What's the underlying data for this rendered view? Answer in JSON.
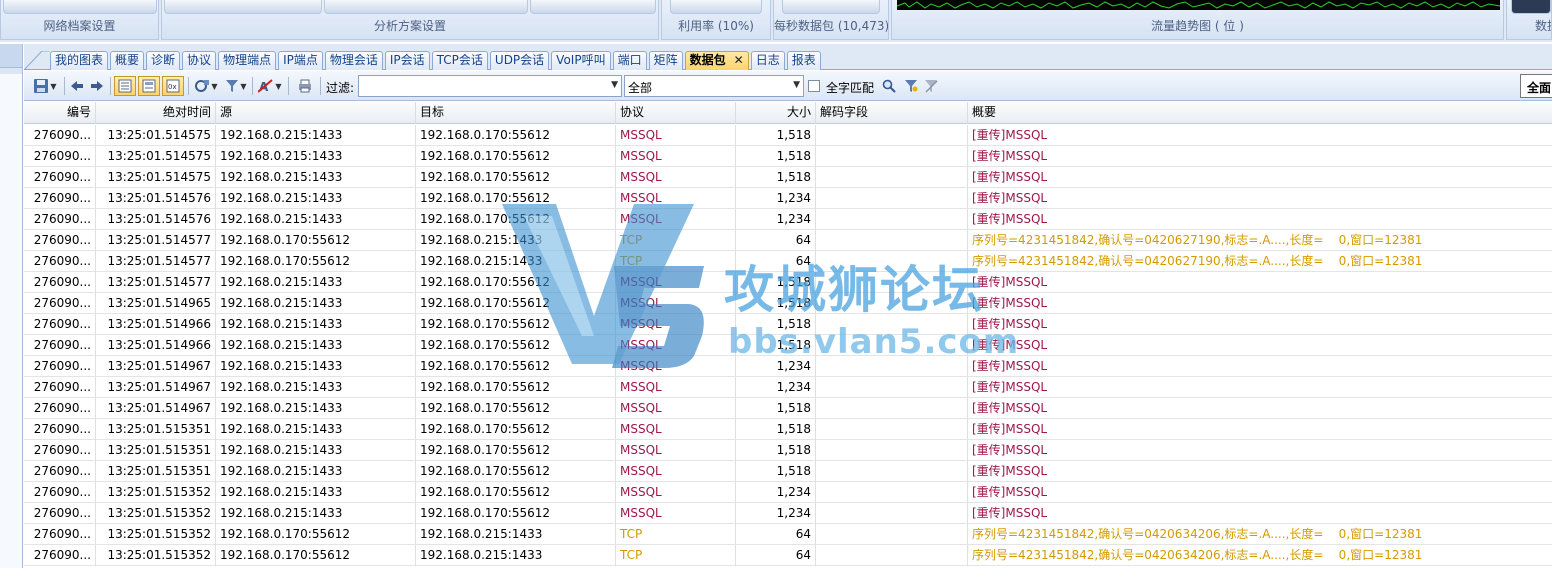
{
  "ribbon": {
    "groups": [
      {
        "caption": "网络档案设置"
      },
      {
        "caption": "分析方案设置"
      },
      {
        "caption": "利用率 (10%)"
      },
      {
        "caption": "每秒数据包 (10,473)"
      },
      {
        "caption": "流量趋势图 ( 位 )"
      },
      {
        "caption": "数据"
      }
    ]
  },
  "tabs": [
    {
      "label": "我的图表"
    },
    {
      "label": "概要"
    },
    {
      "label": "诊断"
    },
    {
      "label": "协议"
    },
    {
      "label": "物理端点"
    },
    {
      "label": "IP端点"
    },
    {
      "label": "物理会话"
    },
    {
      "label": "IP会话"
    },
    {
      "label": "TCP会话"
    },
    {
      "label": "UDP会话"
    },
    {
      "label": "VoIP呼叫"
    },
    {
      "label": "端口"
    },
    {
      "label": "矩阵"
    },
    {
      "label": "数据包",
      "active": true,
      "close": "✕"
    },
    {
      "label": "日志"
    },
    {
      "label": "报表"
    }
  ],
  "toolbar": {
    "filter_label": "过滤:",
    "filter_value": "",
    "scope_value": "全部",
    "full_match_label": "全字匹配",
    "full_button": "全面"
  },
  "grid": {
    "columns": [
      "编号",
      "绝对时间",
      "源",
      "目标",
      "协议",
      "大小",
      "解码字段",
      "概要"
    ],
    "rows": [
      {
        "no": "276090...",
        "time": "13:25:01.514575",
        "src": "192.168.0.215:1433",
        "dst": "192.168.0.170:55612",
        "proto": "MSSQL",
        "size": "1,518",
        "decode": "",
        "summary": "[重传]MSSQL"
      },
      {
        "no": "276090...",
        "time": "13:25:01.514575",
        "src": "192.168.0.215:1433",
        "dst": "192.168.0.170:55612",
        "proto": "MSSQL",
        "size": "1,518",
        "decode": "",
        "summary": "[重传]MSSQL"
      },
      {
        "no": "276090...",
        "time": "13:25:01.514575",
        "src": "192.168.0.215:1433",
        "dst": "192.168.0.170:55612",
        "proto": "MSSQL",
        "size": "1,518",
        "decode": "",
        "summary": "[重传]MSSQL"
      },
      {
        "no": "276090...",
        "time": "13:25:01.514576",
        "src": "192.168.0.215:1433",
        "dst": "192.168.0.170:55612",
        "proto": "MSSQL",
        "size": "1,234",
        "decode": "",
        "summary": "[重传]MSSQL"
      },
      {
        "no": "276090...",
        "time": "13:25:01.514576",
        "src": "192.168.0.215:1433",
        "dst": "192.168.0.170:55612",
        "proto": "MSSQL",
        "size": "1,234",
        "decode": "",
        "summary": "[重传]MSSQL"
      },
      {
        "no": "276090...",
        "time": "13:25:01.514577",
        "src": "192.168.0.170:55612",
        "dst": "192.168.0.215:1433",
        "proto": "TCP",
        "size": "64",
        "decode": "",
        "summary": "序列号=4231451842,确认号=0420627190,标志=.A....,长度=    0,窗口=12381"
      },
      {
        "no": "276090...",
        "time": "13:25:01.514577",
        "src": "192.168.0.170:55612",
        "dst": "192.168.0.215:1433",
        "proto": "TCP",
        "size": "64",
        "decode": "",
        "summary": "序列号=4231451842,确认号=0420627190,标志=.A....,长度=    0,窗口=12381"
      },
      {
        "no": "276090...",
        "time": "13:25:01.514577",
        "src": "192.168.0.215:1433",
        "dst": "192.168.0.170:55612",
        "proto": "MSSQL",
        "size": "1,518",
        "decode": "",
        "summary": "[重传]MSSQL"
      },
      {
        "no": "276090...",
        "time": "13:25:01.514965",
        "src": "192.168.0.215:1433",
        "dst": "192.168.0.170:55612",
        "proto": "MSSQL",
        "size": "1,518",
        "decode": "",
        "summary": "[重传]MSSQL"
      },
      {
        "no": "276090...",
        "time": "13:25:01.514966",
        "src": "192.168.0.215:1433",
        "dst": "192.168.0.170:55612",
        "proto": "MSSQL",
        "size": "1,518",
        "decode": "",
        "summary": "[重传]MSSQL"
      },
      {
        "no": "276090...",
        "time": "13:25:01.514966",
        "src": "192.168.0.215:1433",
        "dst": "192.168.0.170:55612",
        "proto": "MSSQL",
        "size": "1,518",
        "decode": "",
        "summary": "[重传]MSSQL"
      },
      {
        "no": "276090...",
        "time": "13:25:01.514967",
        "src": "192.168.0.215:1433",
        "dst": "192.168.0.170:55612",
        "proto": "MSSQL",
        "size": "1,234",
        "decode": "",
        "summary": "[重传]MSSQL"
      },
      {
        "no": "276090...",
        "time": "13:25:01.514967",
        "src": "192.168.0.215:1433",
        "dst": "192.168.0.170:55612",
        "proto": "MSSQL",
        "size": "1,234",
        "decode": "",
        "summary": "[重传]MSSQL"
      },
      {
        "no": "276090...",
        "time": "13:25:01.514967",
        "src": "192.168.0.215:1433",
        "dst": "192.168.0.170:55612",
        "proto": "MSSQL",
        "size": "1,518",
        "decode": "",
        "summary": "[重传]MSSQL"
      },
      {
        "no": "276090...",
        "time": "13:25:01.515351",
        "src": "192.168.0.215:1433",
        "dst": "192.168.0.170:55612",
        "proto": "MSSQL",
        "size": "1,518",
        "decode": "",
        "summary": "[重传]MSSQL"
      },
      {
        "no": "276090...",
        "time": "13:25:01.515351",
        "src": "192.168.0.215:1433",
        "dst": "192.168.0.170:55612",
        "proto": "MSSQL",
        "size": "1,518",
        "decode": "",
        "summary": "[重传]MSSQL"
      },
      {
        "no": "276090...",
        "time": "13:25:01.515351",
        "src": "192.168.0.215:1433",
        "dst": "192.168.0.170:55612",
        "proto": "MSSQL",
        "size": "1,518",
        "decode": "",
        "summary": "[重传]MSSQL"
      },
      {
        "no": "276090...",
        "time": "13:25:01.515352",
        "src": "192.168.0.215:1433",
        "dst": "192.168.0.170:55612",
        "proto": "MSSQL",
        "size": "1,234",
        "decode": "",
        "summary": "[重传]MSSQL"
      },
      {
        "no": "276090...",
        "time": "13:25:01.515352",
        "src": "192.168.0.215:1433",
        "dst": "192.168.0.170:55612",
        "proto": "MSSQL",
        "size": "1,234",
        "decode": "",
        "summary": "[重传]MSSQL"
      },
      {
        "no": "276090...",
        "time": "13:25:01.515352",
        "src": "192.168.0.170:55612",
        "dst": "192.168.0.215:1433",
        "proto": "TCP",
        "size": "64",
        "decode": "",
        "summary": "序列号=4231451842,确认号=0420634206,标志=.A....,长度=    0,窗口=12381"
      },
      {
        "no": "276090...",
        "time": "13:25:01.515352",
        "src": "192.168.0.170:55612",
        "dst": "192.168.0.215:1433",
        "proto": "TCP",
        "size": "64",
        "decode": "",
        "summary": "序列号=4231451842,确认号=0420634206,标志=.A....,长度=    0,窗口=12381"
      }
    ]
  },
  "watermark": {
    "title": "攻城狮论坛",
    "url": "bbs.vlan5.com"
  },
  "colors": {
    "mssql": "#a0184a",
    "tcp": "#d39a00",
    "ribbon_bg": "#dfe8f5",
    "trend_line": "#2bd12b"
  },
  "icons": [
    "save-icon",
    "back-arrow-icon",
    "forward-arrow-icon",
    "list-view-icon",
    "detail-view-icon",
    "hex-view-icon",
    "decode-icon",
    "filter-icon",
    "highlight-icon",
    "print-icon",
    "search-icon",
    "advanced-filter-icon",
    "clear-filter-icon"
  ]
}
